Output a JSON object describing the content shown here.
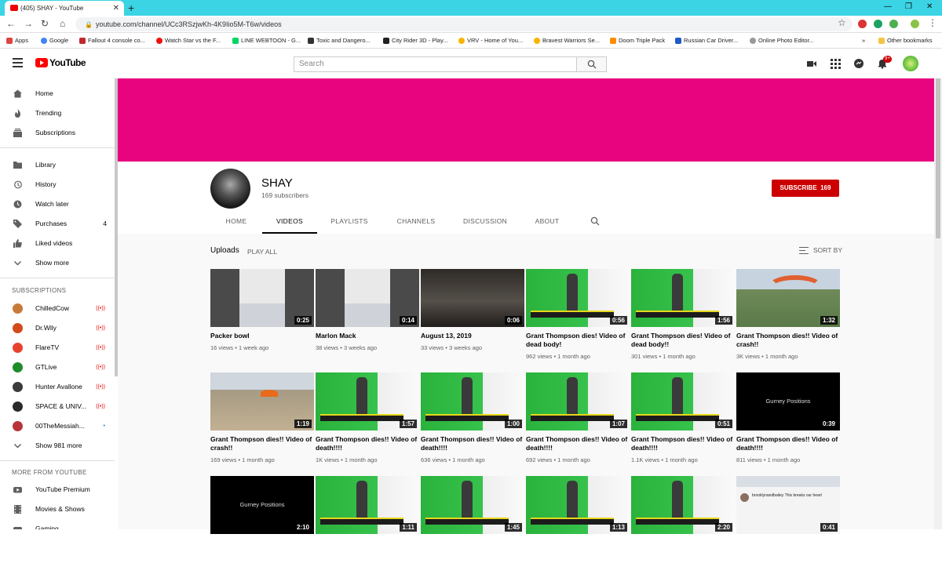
{
  "browser": {
    "tab_title": "(405) SHAY - YouTube",
    "url": "youtube.com/channel/UCc3RSzjwKh-4K9Iio5M-T6w/videos",
    "bookmarks": [
      "Apps",
      "Google",
      "Fallout 4 console co...",
      "Watch Star vs the F...",
      "LINE WEBTOON - G...",
      "Toxic and Dangero...",
      "City Rider 3D - Play...",
      "VRV - Home of You...",
      "Bravest Warriors Se...",
      "Doom Triple Pack",
      "Russian Car Driver...",
      "Online Photo Editor..."
    ],
    "other_bookmarks": "Other bookmarks",
    "overflow": "»"
  },
  "header": {
    "logo": "YouTube",
    "search_placeholder": "Search",
    "notif_count": "9+"
  },
  "sidebar": {
    "main": [
      {
        "label": "Home",
        "icon": "home-icon"
      },
      {
        "label": "Trending",
        "icon": "flame-icon"
      },
      {
        "label": "Subscriptions",
        "icon": "subscriptions-icon"
      }
    ],
    "library": [
      {
        "label": "Library",
        "icon": "folder-icon",
        "count": ""
      },
      {
        "label": "History",
        "icon": "history-icon",
        "count": ""
      },
      {
        "label": "Watch later",
        "icon": "clock-icon",
        "count": ""
      },
      {
        "label": "Purchases",
        "icon": "tag-icon",
        "count": "4"
      },
      {
        "label": "Liked videos",
        "icon": "thumbs-up-icon",
        "count": ""
      },
      {
        "label": "Show more",
        "icon": "chevron-down-icon",
        "count": ""
      }
    ],
    "subscriptions_heading": "SUBSCRIPTIONS",
    "subscriptions": [
      {
        "label": "ChilledCow",
        "color": "#c77b3a",
        "live": "((•))"
      },
      {
        "label": "Dr.Wily",
        "color": "#d24a1c",
        "live": "((•))"
      },
      {
        "label": "FlareTV",
        "color": "#e8422e",
        "live": "((•))"
      },
      {
        "label": "GTLive",
        "color": "#1d8c2a",
        "live": "((•))"
      },
      {
        "label": "Hunter Avallone",
        "color": "#3b3b3b",
        "live": "((•))"
      },
      {
        "label": "SPACE & UNIV...",
        "color": "#2a2a2a",
        "live": "((•))"
      },
      {
        "label": "00TheMessiah...",
        "color": "#b9343a",
        "live": "•"
      }
    ],
    "show_more_subs": "Show 981 more",
    "more_heading": "MORE FROM YOUTUBE",
    "more": [
      {
        "label": "YouTube Premium",
        "icon": "youtube-icon"
      },
      {
        "label": "Movies & Shows",
        "icon": "film-icon"
      },
      {
        "label": "Gaming",
        "icon": "gaming-icon"
      }
    ]
  },
  "channel": {
    "name": "SHAY",
    "subscribers": "169 subscribers",
    "subscribe_label": "SUBSCRIBE",
    "subscribe_count": "169",
    "banner_color": "#e9047f",
    "tabs": [
      "HOME",
      "VIDEOS",
      "PLAYLISTS",
      "CHANNELS",
      "DISCUSSION",
      "ABOUT"
    ],
    "active_tab": "VIDEOS"
  },
  "uploads": {
    "heading": "Uploads",
    "play_all": "PLAY ALL",
    "sort_by": "SORT BY",
    "videos": [
      {
        "title": "Packer bowl",
        "views": "16 views",
        "age": "1 week ago",
        "duration": "0:25",
        "thumb": "phone"
      },
      {
        "title": "Marlon Mack",
        "views": "38 views",
        "age": "3 weeks ago",
        "duration": "0:14",
        "thumb": "phone"
      },
      {
        "title": "August 13, 2019",
        "views": "33 views",
        "age": "3 weeks ago",
        "duration": "0:06",
        "thumb": "dark"
      },
      {
        "title": "Grant Thompson dies! Video of dead body!",
        "views": "962 views",
        "age": "1 month ago",
        "duration": "0:56",
        "thumb": "green"
      },
      {
        "title": "Grant Thompson dies! Video of dead body!!",
        "views": "301 views",
        "age": "1 month ago",
        "duration": "1:56",
        "thumb": "green"
      },
      {
        "title": "Grant Thompson dies!! Video of crash!!",
        "views": "3K views",
        "age": "1 month ago",
        "duration": "1:32",
        "thumb": "sky"
      },
      {
        "title": "Grant Thompson dies!! Video of crash!!",
        "views": "169 views",
        "age": "1 month ago",
        "duration": "1:19",
        "thumb": "mountain"
      },
      {
        "title": "Grant Thompson dies!! Video of death!!!!",
        "views": "1K views",
        "age": "1 month ago",
        "duration": "1:57",
        "thumb": "green"
      },
      {
        "title": "Grant Thompson dies!! Video of death!!!!",
        "views": "636 views",
        "age": "1 month ago",
        "duration": "1:00",
        "thumb": "green"
      },
      {
        "title": "Grant Thompson dies!! Video of death!!!!",
        "views": "692 views",
        "age": "1 month ago",
        "duration": "1:07",
        "thumb": "green"
      },
      {
        "title": "Grant Thompson dies!! Video of death!!!!",
        "views": "1.1K views",
        "age": "1 month ago",
        "duration": "0:51",
        "thumb": "green"
      },
      {
        "title": "Grant Thompson dies!! Video of death!!!!",
        "views": "811 views",
        "age": "1 month ago",
        "duration": "0:39",
        "thumb": "black",
        "caption": "Gurney Positions"
      },
      {
        "title": "",
        "views": "",
        "age": "",
        "duration": "2:10",
        "thumb": "black",
        "caption": "Gurney Positions"
      },
      {
        "title": "",
        "views": "",
        "age": "",
        "duration": "1:11",
        "thumb": "green"
      },
      {
        "title": "",
        "views": "",
        "age": "",
        "duration": "1:45",
        "thumb": "green"
      },
      {
        "title": "",
        "views": "",
        "age": "",
        "duration": "1:13",
        "thumb": "green"
      },
      {
        "title": "",
        "views": "",
        "age": "",
        "duration": "2:20",
        "thumb": "green"
      },
      {
        "title": "",
        "views": "",
        "age": "",
        "duration": "0:41",
        "thumb": "social",
        "social_text": "brooklynandbailey This breaks our heart"
      }
    ]
  }
}
